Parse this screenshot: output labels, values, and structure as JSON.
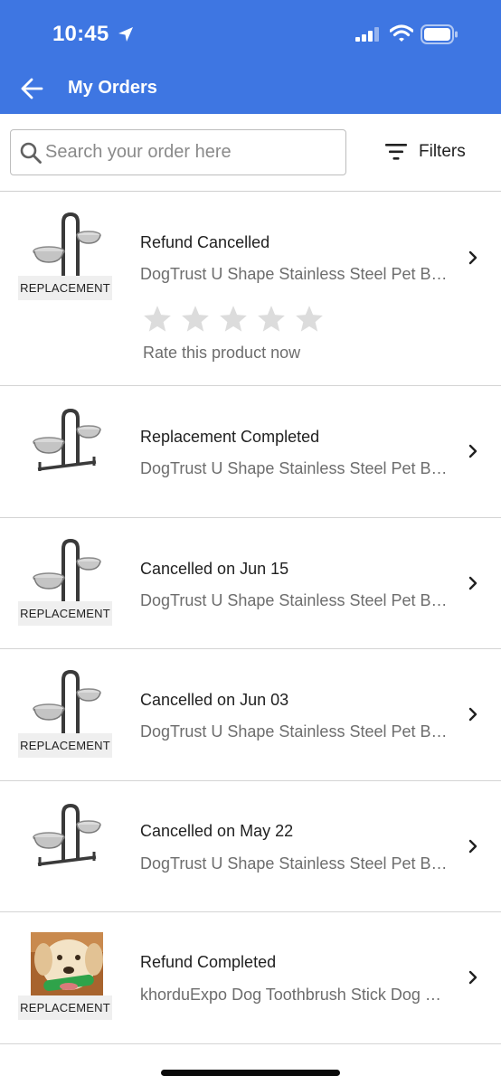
{
  "status_bar": {
    "time": "10:45"
  },
  "header": {
    "title": "My Orders"
  },
  "search": {
    "placeholder": "Search your order here",
    "value": ""
  },
  "filters": {
    "label": "Filters"
  },
  "colors": {
    "accent": "#3e76e2",
    "tag_bg": "#efefef",
    "star_empty": "#dcdcdc"
  },
  "rating": {
    "prompt": "Rate this product now",
    "stars": 0,
    "max_stars": 5
  },
  "orders": [
    {
      "status": "Refund Cancelled",
      "product": "DogTrust U Shape Stainless Steel Pet Bowl Stand",
      "tag": "REPLACEMENT",
      "image": "bowl-stand-image"
    },
    {
      "status": "Replacement Completed",
      "product": "DogTrust U Shape Stainless Steel Pet Bowl Stand",
      "tag": "",
      "image": "bowl-stand-image"
    },
    {
      "status": "Cancelled on Jun 15",
      "product": "DogTrust U Shape Stainless Steel Pet Bowl Stand",
      "tag": "REPLACEMENT",
      "image": "bowl-stand-image"
    },
    {
      "status": "Cancelled on Jun 03",
      "product": "DogTrust U Shape Stainless Steel Pet Bowl Stand",
      "tag": "REPLACEMENT",
      "image": "bowl-stand-image"
    },
    {
      "status": "Cancelled on May 22",
      "product": "DogTrust U Shape Stainless Steel Pet Bowl Stand",
      "tag": "",
      "image": "bowl-stand-image"
    },
    {
      "status": "Refund Completed",
      "product": "khorduExpo Dog Toothbrush Stick Dog Chew Toy",
      "tag": "REPLACEMENT",
      "image": "dog-toothbrush-image"
    }
  ]
}
